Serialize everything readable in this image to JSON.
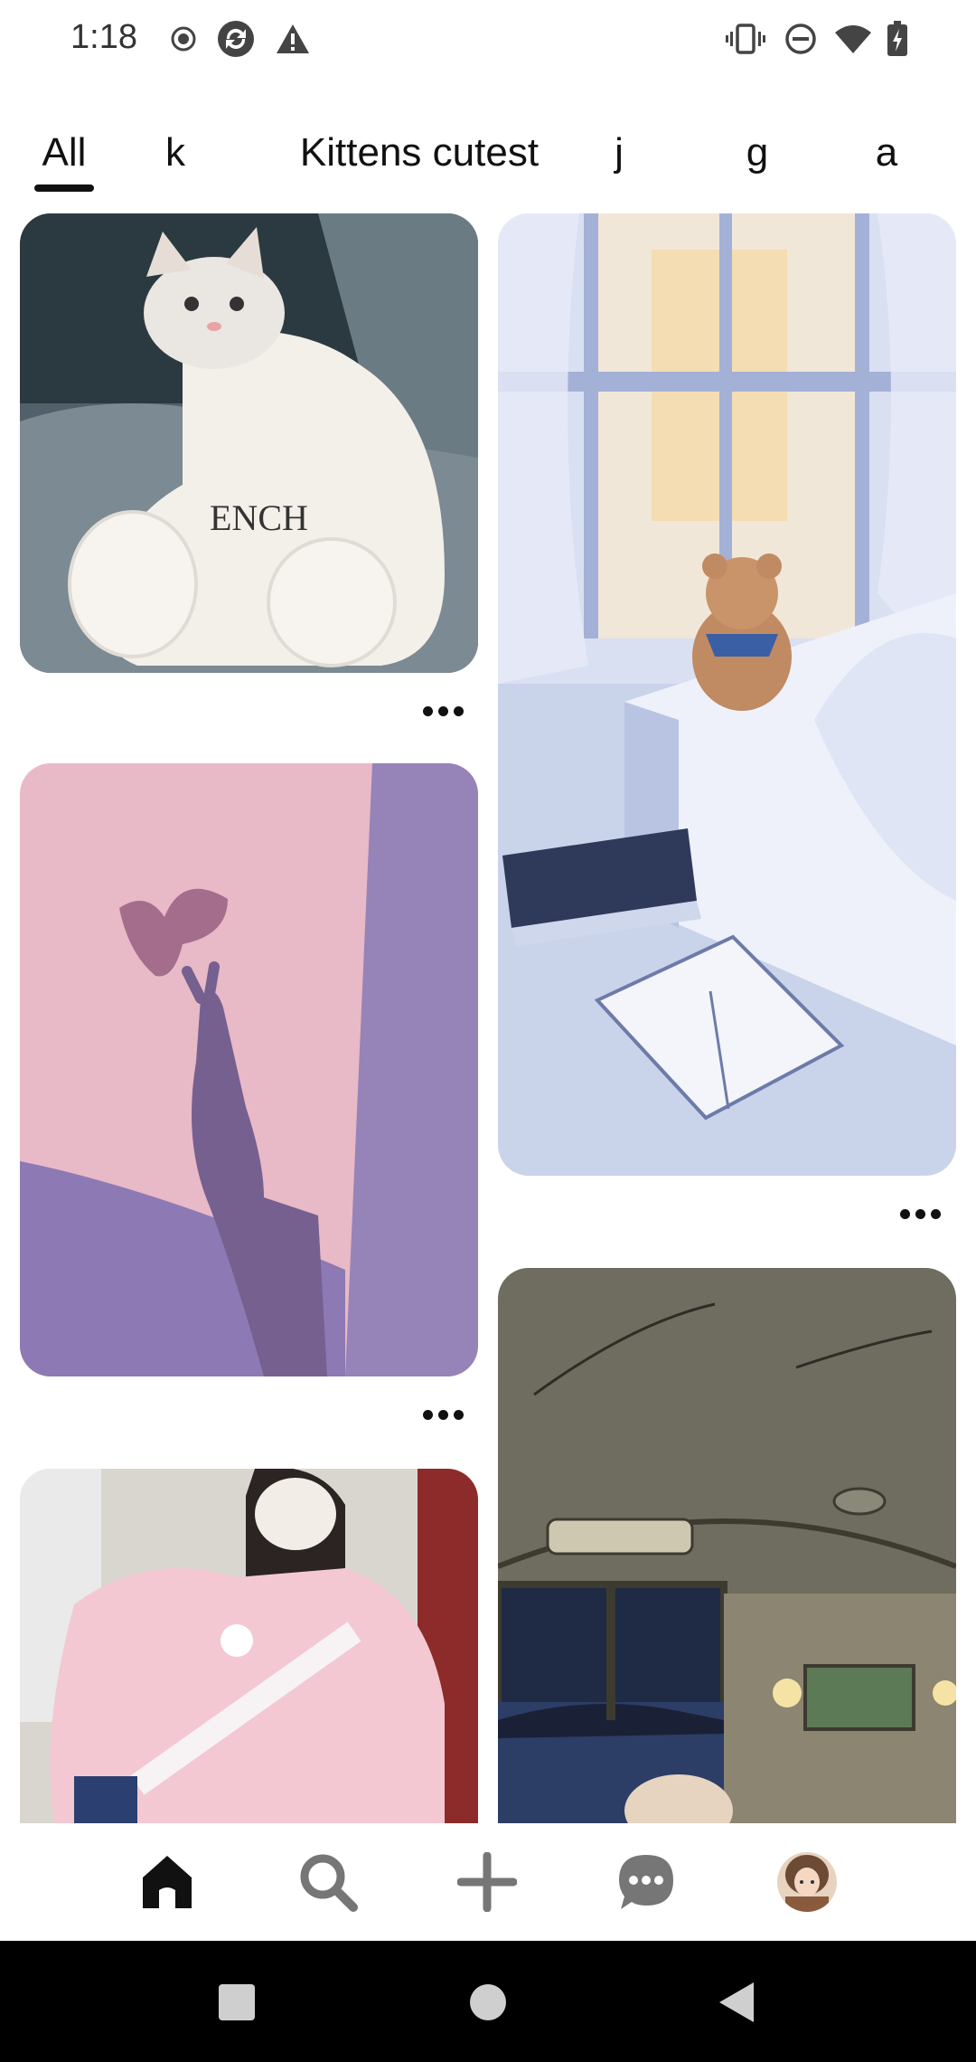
{
  "status_bar": {
    "time": "1:18",
    "left_icons": [
      "record-icon",
      "sync-icon",
      "warning-icon"
    ],
    "right_icons": [
      "vibrate-icon",
      "dnd-icon",
      "wifi-icon",
      "battery-charging-icon"
    ]
  },
  "tabs": {
    "items": [
      {
        "label": "All",
        "selected": true
      },
      {
        "label": "k",
        "selected": false
      },
      {
        "label": "Kittens cutest",
        "selected": false
      },
      {
        "label": "j",
        "selected": false
      },
      {
        "label": "g",
        "selected": false
      },
      {
        "label": "a",
        "selected": false
      }
    ]
  },
  "feed": {
    "pins": [
      {
        "name": "kitten-in-hoodie",
        "icon": "image-kitten"
      },
      {
        "name": "butterfly-hand-shadow",
        "icon": "image-butterfly"
      },
      {
        "name": "pink-hoodie-girl",
        "icon": "image-girl"
      },
      {
        "name": "teddy-bear-bedroom",
        "icon": "image-bedroom"
      },
      {
        "name": "night-train-interior",
        "icon": "image-train"
      }
    ]
  },
  "bottom_nav": {
    "items": [
      "home-icon",
      "search-icon",
      "create-icon",
      "messages-icon",
      "profile-avatar"
    ],
    "active": "home-icon"
  },
  "system_nav": {
    "items": [
      "recents-button",
      "home-button",
      "back-button"
    ]
  },
  "colors": {
    "accent": "#111111",
    "background": "#ffffff",
    "system_bar": "#000000"
  }
}
